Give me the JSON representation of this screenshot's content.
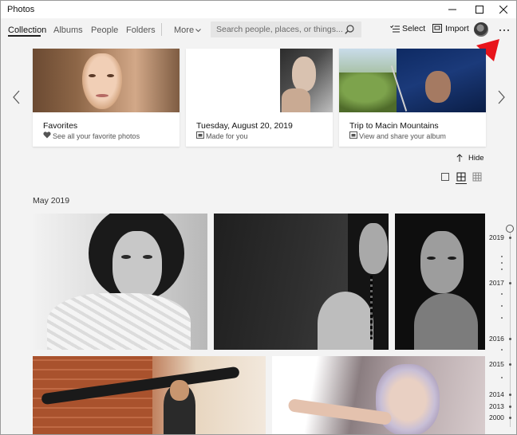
{
  "window": {
    "title": "Photos"
  },
  "nav": {
    "tabs": [
      {
        "label": "Collection",
        "active": true
      },
      {
        "label": "Albums",
        "active": false
      },
      {
        "label": "People",
        "active": false
      },
      {
        "label": "Folders",
        "active": false
      }
    ],
    "more_label": "More",
    "search_placeholder": "Search people, places, or things...",
    "select_label": "Select",
    "import_label": "Import"
  },
  "cards": [
    {
      "title": "Favorites",
      "subtitle": "See all your favorite photos",
      "icon": "heart-icon"
    },
    {
      "title": "Tuesday, August 20, 2019",
      "subtitle": "Made for you",
      "icon": "photo-stack-icon"
    },
    {
      "title": "Trip to Macin Mountains",
      "subtitle": "View and share your album",
      "icon": "photo-stack-icon"
    }
  ],
  "hide_label": "Hide",
  "section": {
    "label": "May 2019"
  },
  "timeline": {
    "years": [
      "2019",
      "2017",
      "2016",
      "2015",
      "2014",
      "2013",
      "2000"
    ]
  },
  "colors": {
    "accent_arrow": "#e8141b",
    "background": "#f3f3f3"
  }
}
